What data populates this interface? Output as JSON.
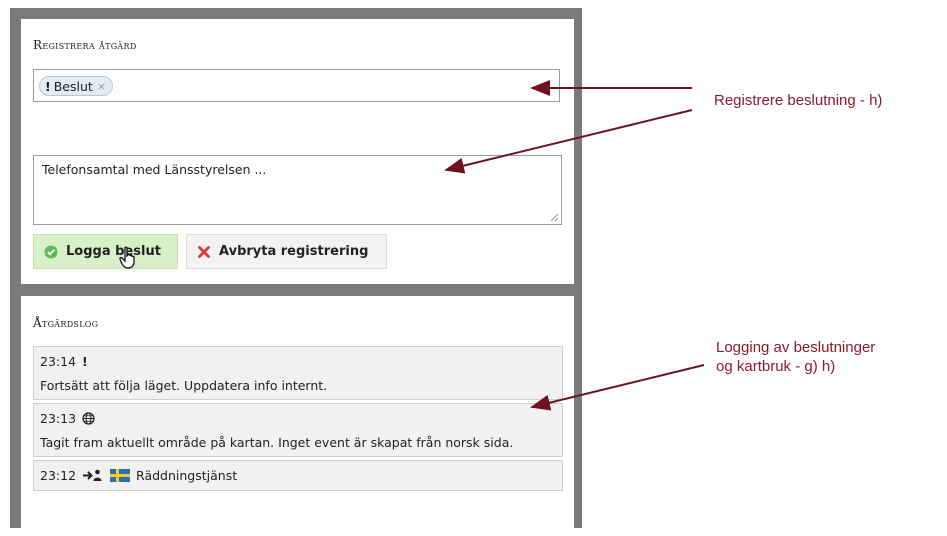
{
  "register_panel": {
    "title": "Registrera åtgärd",
    "tag": {
      "label": "Beslut",
      "icon": "exclamation-icon",
      "remove_icon": "close-icon"
    },
    "textarea_value": "Telefonsamtal med Länsstyrelsen ...",
    "log_button": {
      "label": "Logga beslut",
      "icon": "check-circle-icon"
    },
    "cancel_button": {
      "label": "Avbryta registrering",
      "icon": "x-icon"
    }
  },
  "log_panel": {
    "title": "Åtgärdslog",
    "entries": [
      {
        "time": "23:14",
        "icon": "exclamation-icon",
        "text": "Fortsätt att följa läget. Uppdatera info internt."
      },
      {
        "time": "23:13",
        "icon": "globe-icon",
        "text": "Tagit fram aktuellt område på kartan. Inget event är skapat från norsk sida."
      },
      {
        "time": "23:12",
        "icon": "arrow-person-icon",
        "flag": "sweden-flag-icon",
        "text": "Räddningstjänst"
      }
    ]
  },
  "annotations": {
    "first": "Registrere beslutning - h)",
    "second_line1": "Logging av beslutninger",
    "second_line2": "og kartbruk - g) h)"
  },
  "colors": {
    "annotation": "#8a1b2b",
    "frame": "#7a7a7a",
    "log_button_bg": "#d8f0c8"
  }
}
